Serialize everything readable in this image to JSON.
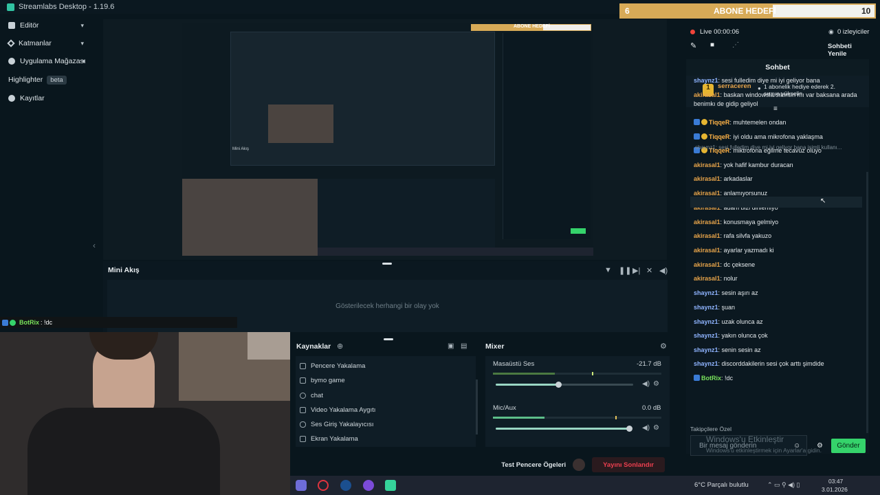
{
  "window": {
    "title": "Streamlabs Desktop - 1.19.6"
  },
  "sidebar": {
    "items": [
      {
        "label": "Editör"
      },
      {
        "label": "Katmanlar"
      },
      {
        "label": "Uygulama Mağazası"
      },
      {
        "label": "Highlighter",
        "badge": "beta"
      },
      {
        "label": "Kayıtlar"
      }
    ]
  },
  "mini": {
    "title": "Mini Akış",
    "empty_text": "Gösterilecek herhangi bir olay yok"
  },
  "webcam": {
    "overlay_user": "BotRix",
    "overlay_text": ": !dc"
  },
  "sources": {
    "title": "Kaynaklar",
    "items": [
      {
        "label": "Pencere Yakalama",
        "icon": "window-icon"
      },
      {
        "label": "bymo game",
        "icon": "window-icon"
      },
      {
        "label": "chat",
        "icon": "globe-icon"
      },
      {
        "label": "Video Yakalama Aygıtı",
        "icon": "camera-icon"
      },
      {
        "label": "Ses Giriş Yakalayıcısı",
        "icon": "mic-icon"
      },
      {
        "label": "Ekran Yakalama",
        "icon": "monitor-icon"
      }
    ]
  },
  "mixer": {
    "title": "Mixer",
    "channels": [
      {
        "name": "Masaüstü Ses",
        "db": "-21.7 dB",
        "volume": 0.48
      },
      {
        "name": "Mic/Aux",
        "db": "0.0 dB",
        "volume": 1.0
      }
    ]
  },
  "footer": {
    "test_label": "Test Pencere Ögeleri",
    "stop_label": "Yayını Sonlandır"
  },
  "goal": {
    "left_value": "6",
    "title": "ABONE HEDEFİ",
    "right_value": "10",
    "progress": 0.6
  },
  "chat": {
    "live_label": "Live 00:00:06",
    "viewers": "0 izleyiciler",
    "refresh": "Sohbeti Yenile",
    "title": "Sohbet",
    "pinned_user": "serraceren",
    "pinned_count": "1",
    "pinned_text": "1 abonelik hediye ederek 2. sıraya yükselin",
    "reply_note": "shaynz1: sesi fulledim diye mi iyi geliyor bana isimli kullanı...",
    "messages": [
      {
        "user": "shaynz1",
        "text": "sesi fulledim diye mi iyi geliyor bana",
        "cls": "user-b"
      },
      {
        "user": "akirasal1",
        "text": "baskan windowsla sıkıntın mı var baksana arada",
        "cls": "user-a"
      },
      {
        "user": "",
        "text": "benimkı de gidip geliyol",
        "cls": ""
      },
      {
        "user": "TiqqeR",
        "text": "muhtemelen ondan",
        "cls": "user-c"
      },
      {
        "user": "TiqqeR",
        "text": "iyi oldu ama mikrofona yaklaşma",
        "cls": "user-c"
      },
      {
        "user": "TiqqeR",
        "text": "miktrofona eğilme tecavüz oluyo",
        "cls": "user-c"
      },
      {
        "user": "akirasal1",
        "text": "yok hafif kambur duracan",
        "cls": "user-a"
      },
      {
        "user": "akirasal1",
        "text": "arkadaslar",
        "cls": "user-a"
      },
      {
        "user": "akirasal1",
        "text": "anlamıyorsunuz",
        "cls": "user-a"
      },
      {
        "user": "akirasal1",
        "text": "adam bizi dinlemiyo",
        "cls": "user-a"
      },
      {
        "user": "akirasal1",
        "text": "konusmaya gelmiyo",
        "cls": "user-a"
      },
      {
        "user": "akirasal1",
        "text": "rafa silvfa yakuzo",
        "cls": "user-a"
      },
      {
        "user": "akirasal1",
        "text": "ayarlar yazmadı ki",
        "cls": "user-a"
      },
      {
        "user": "akirasal1",
        "text": "dc çeksene",
        "cls": "user-a"
      },
      {
        "user": "akirasal1",
        "text": "nolur",
        "cls": "user-a"
      },
      {
        "user": "shaynz1",
        "text": "sesin aşırı az",
        "cls": "user-b"
      },
      {
        "user": "shaynz1",
        "text": "şuan",
        "cls": "user-b"
      },
      {
        "user": "shaynz1",
        "text": "uzak olunca az",
        "cls": "user-b"
      },
      {
        "user": "shaynz1",
        "text": "yakın olunca çok",
        "cls": "user-b"
      },
      {
        "user": "shaynz1",
        "text": "senin sesin az",
        "cls": "user-b"
      },
      {
        "user": "shaynz1",
        "text": "discorddakilerin sesi çok arttı şimdide",
        "cls": "user-b"
      },
      {
        "user": "BotRix",
        "text": "!dc",
        "cls": "user-bot"
      }
    ],
    "follower_only": "Takipçilere Özel",
    "input_placeholder": "Bir mesaj gönderin",
    "send": "Gönder"
  },
  "watermark": {
    "line1": "Windows'u Etkinleştir",
    "line2": "Windows'u etkinleştirmek için Ayarlar'a gidin."
  },
  "taskbar": {
    "weather": "6°C  Parçalı bulutlu",
    "time": "03:47",
    "date": "3.01.2026"
  },
  "preview": {
    "nested_title": "Mini Akış",
    "nested_goal": "ABONE HEDEFİ"
  }
}
